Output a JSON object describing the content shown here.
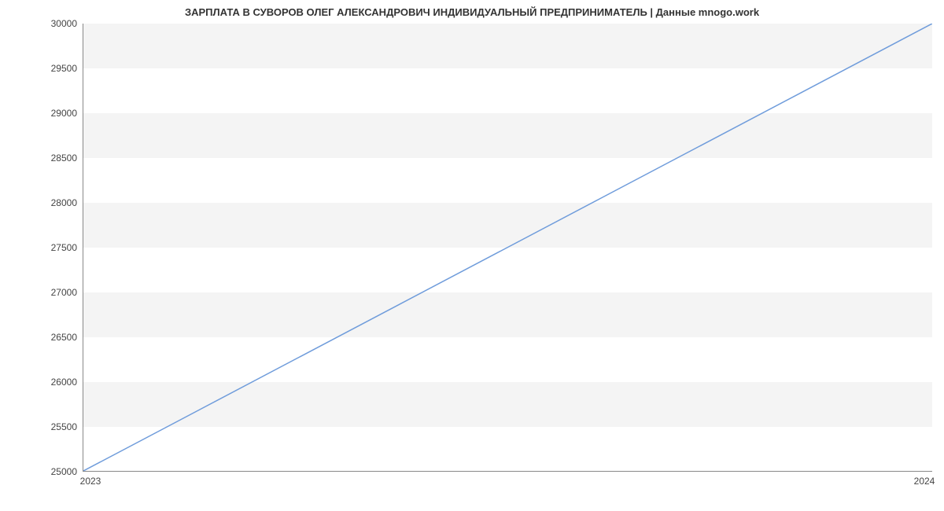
{
  "chart_data": {
    "type": "line",
    "title": "ЗАРПЛАТА В СУВОРОВ ОЛЕГ АЛЕКСАНДРОВИЧ ИНДИВИДУАЛЬНЫЙ ПРЕДПРИНИМАТЕЛЬ | Данные mnogo.work",
    "x": [
      2023,
      2024
    ],
    "values": [
      25000,
      30000
    ],
    "xlabel": "",
    "ylabel": "",
    "ylim": [
      25000,
      30000
    ],
    "y_ticks": [
      25000,
      25500,
      26000,
      26500,
      27000,
      27500,
      28000,
      28500,
      29000,
      29500,
      30000
    ],
    "x_ticks": [
      2023,
      2024
    ],
    "line_color": "#6f9cdb",
    "band_color": "#f4f4f4"
  }
}
